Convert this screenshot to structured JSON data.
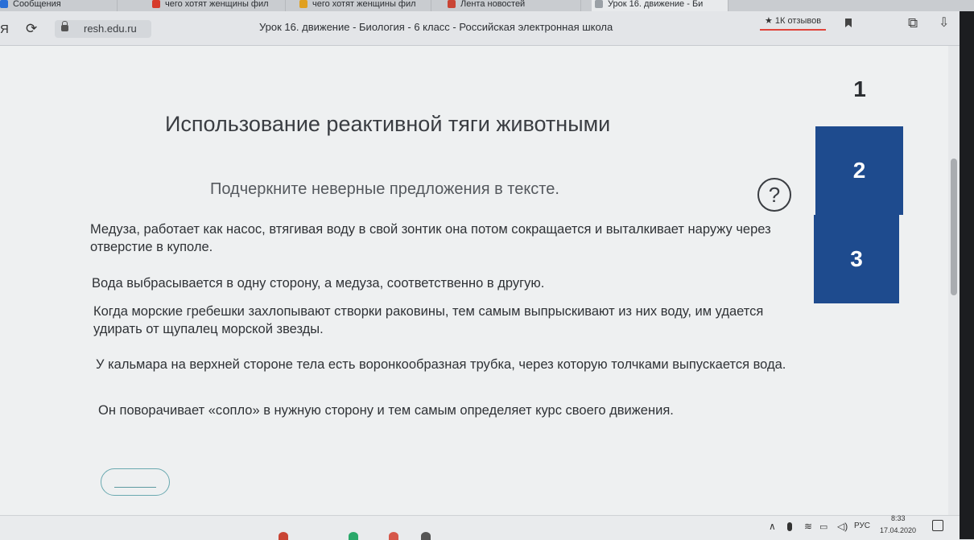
{
  "tabs": [
    {
      "label": "Сообщения",
      "color": "#2a6fd6"
    },
    {
      "label": "чего хотят женщины фил",
      "color": "#d63a2a"
    },
    {
      "label": "чего хотят женщины фил",
      "color": "#e0a020"
    },
    {
      "label": "Лента новостей",
      "color": "#c94434"
    },
    {
      "label": "Урок 16. движение - Би",
      "color": "#9aa0a6"
    }
  ],
  "toolbar": {
    "back_glyph": "Я",
    "domain": "resh.edu.ru",
    "page_title": "Урок 16. движение - Биология - 6 класс - Российская электронная школа",
    "reviews": "★ 1К отзывов"
  },
  "main": {
    "heading": "Использование реактивной тяги животными",
    "task": "Подчеркните неверные предложения в тексте.",
    "help": "?",
    "paragraphs": [
      "Медуза, работает как насос, втягивая воду в свой зонтик она потом сокращается и выталкивает наружу через отверстие в куполе.",
      "Вода выбрасывается в одну сторону, а медуза, соответственно в другую.",
      "Когда морские гребешки захлопывают створки раковины, тем самым выпрыскивают из них воду, им удается удирать от щупалец морской звезды.",
      "У кальмара на верхней стороне тела есть воронкообразная трубка, через которую толчками выпускается вода.",
      "Он поворачивает «сопло» в нужную сторону и тем самым определяет курс своего движения."
    ]
  },
  "steps": [
    "1",
    "2",
    "3"
  ],
  "colors": {
    "step_accent": "#1e4b8e",
    "answer_border": "#6aa9b0"
  },
  "taskbar": {
    "lang": "РУС",
    "time": "8:33",
    "date": "17.04.2020"
  }
}
